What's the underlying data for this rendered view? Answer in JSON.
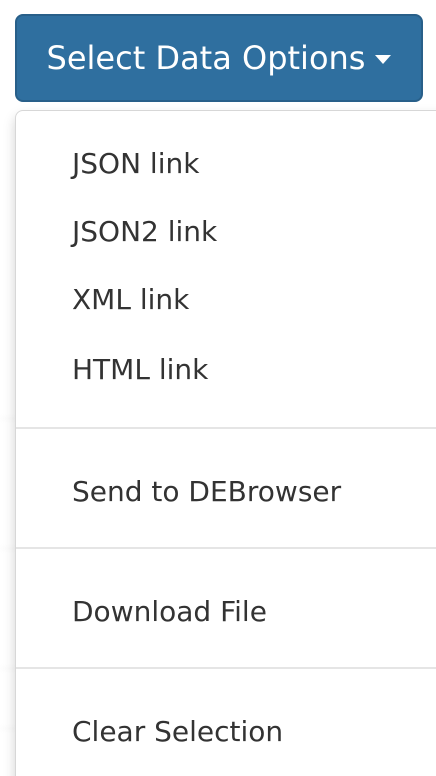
{
  "dropdown": {
    "button_label": "Select Data Options",
    "caret_icon": "caret-down-icon",
    "button_color": "#2f6f9f"
  },
  "menu": {
    "items": [
      {
        "label": "JSON link"
      },
      {
        "label": "JSON2 link"
      },
      {
        "label": "XML link"
      },
      {
        "label": "HTML link"
      },
      {
        "label": "Send to DEBrowser"
      },
      {
        "label": "Download File"
      },
      {
        "label": "Clear Selection"
      }
    ]
  }
}
